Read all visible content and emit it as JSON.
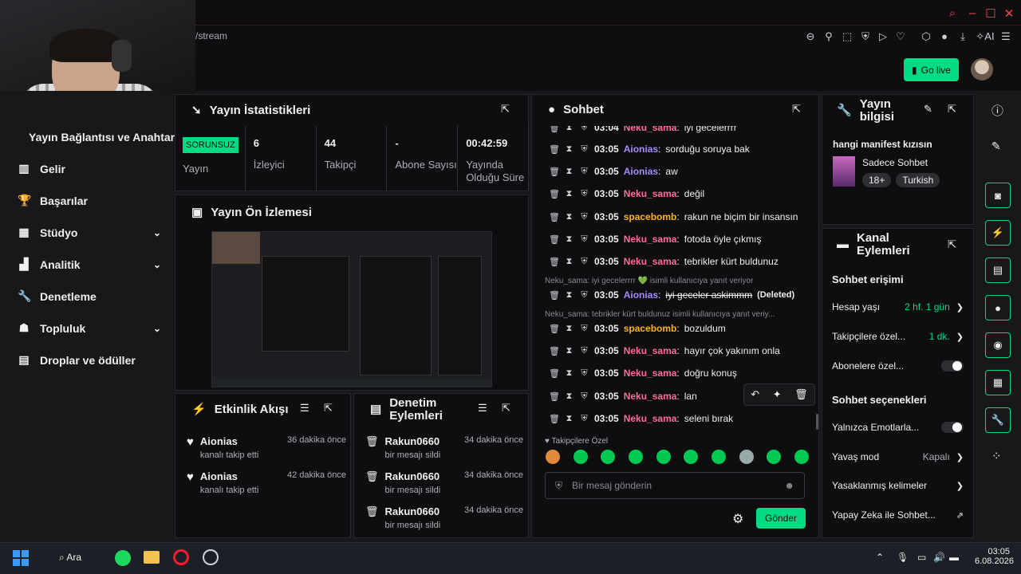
{
  "browser": {
    "url": "/stream",
    "ai_label": "AI"
  },
  "header": {
    "go_live": "Go live"
  },
  "sidebar": {
    "partial_item": "Yayın Bağlantısı ve Anahtarı",
    "items": [
      {
        "label": "Gelir",
        "icon": "bank-icon",
        "chevron": false
      },
      {
        "label": "Başarılar",
        "icon": "trophy-icon",
        "chevron": false
      },
      {
        "label": "Stüdyo",
        "icon": "studio-icon",
        "chevron": true
      },
      {
        "label": "Analitik",
        "icon": "chart-icon",
        "chevron": true
      },
      {
        "label": "Denetleme",
        "icon": "wrench-icon",
        "chevron": false
      },
      {
        "label": "Topluluk",
        "icon": "community-icon",
        "chevron": true
      },
      {
        "label": "Droplar ve ödüller",
        "icon": "gift-icon",
        "chevron": false
      }
    ]
  },
  "stats": {
    "title": "Yayın İstatistikleri",
    "status_badge": "SORUNSUZ",
    "columns": [
      {
        "value": "",
        "label": "Yayın"
      },
      {
        "value": "6",
        "label": "İzleyici"
      },
      {
        "value": "44",
        "label": "Takipçi"
      },
      {
        "value": "-",
        "label": "Abone Sayısı"
      },
      {
        "value": "00:42:59",
        "label": "Yayında Olduğu Süre"
      }
    ]
  },
  "preview": {
    "title": "Yayın Ön İzlemesi"
  },
  "activity": {
    "title": "Etkinlik Akışı",
    "items": [
      {
        "name": "Aionias",
        "desc": "kanalı takip etti",
        "time": "36 dakika önce"
      },
      {
        "name": "Aionias",
        "desc": "kanalı takip etti",
        "time": "42 dakika önce"
      }
    ]
  },
  "moderation": {
    "title": "Denetim Eylemleri",
    "items": [
      {
        "name": "Rakun0660",
        "desc": "bir mesajı sildi",
        "time": "34 dakika önce"
      },
      {
        "name": "Rakun0660",
        "desc": "bir mesajı sildi",
        "time": "34 dakika önce"
      },
      {
        "name": "Rakun0660",
        "desc": "bir mesajı sildi",
        "time": "34 dakika önce"
      }
    ]
  },
  "chat": {
    "title": "Sohbet",
    "messages": [
      {
        "time": "03:04",
        "user": "Neku_sama",
        "color": "#ff6b9a",
        "text": "iyi gecelerrrr"
      },
      {
        "time": "03:05",
        "user": "Aionias",
        "color": "#a78bfa",
        "text": "sorduğu soruya bak"
      },
      {
        "time": "03:05",
        "user": "Aionias",
        "color": "#a78bfa",
        "text": "aw"
      },
      {
        "time": "03:05",
        "user": "Neku_sama",
        "color": "#ff6b9a",
        "text": "değil"
      },
      {
        "time": "03:05",
        "user": "spacebomb",
        "color": "#ffb020",
        "text": "rakun ne biçim bir insansın"
      },
      {
        "time": "03:05",
        "user": "Neku_sama",
        "color": "#ff6b9a",
        "text": "fotoda öyle çıkmış"
      },
      {
        "time": "03:05",
        "user": "Neku_sama",
        "color": "#ff6b9a",
        "text": "tebrikler kürt buldunuz"
      },
      {
        "time": "03:05",
        "user": "Aionias",
        "color": "#a78bfa",
        "text": "iyi geceler askimmm",
        "deleted": "(Deleted)"
      },
      {
        "time": "03:05",
        "user": "spacebomb",
        "color": "#ffb020",
        "text": "bozuldum"
      },
      {
        "time": "03:05",
        "user": "Neku_sama",
        "color": "#ff6b9a",
        "text": "hayır çok yakınım onla"
      },
      {
        "time": "03:05",
        "user": "Neku_sama",
        "color": "#ff6b9a",
        "text": "doğru konuş"
      },
      {
        "time": "03:05",
        "user": "Neku_sama",
        "color": "#ff6b9a",
        "text": "lan"
      },
      {
        "time": "03:05",
        "user": "Neku_sama",
        "color": "#ff6b9a",
        "text": "seleni bırak"
      }
    ],
    "reply_notes": [
      "Neku_sama: iyi gecelerrrr 💚 isimli kullanıcıya yanıt veriyor",
      "Neku_sama: tebrikler kürt buldunuz isimli kullanıcıya yanıt veriy..."
    ],
    "followers_only": "Takipçilere Özel",
    "input_placeholder": "Bir mesaj gönderin",
    "send": "Gönder"
  },
  "stream_info": {
    "title": "Yayın bilgisi",
    "stream_title": "hangi manifest kızısın",
    "category": "Sadece Sohbet",
    "tags": [
      "18+",
      "Turkish"
    ]
  },
  "channel_actions": {
    "title": "Kanal Eylemleri",
    "chat_access": "Sohbet erişimi",
    "account_age_label": "Hesap yaşı",
    "account_age_value": "2 hf. 1 gün",
    "followers_label": "Takipçilere özel...",
    "followers_value": "1 dk.",
    "subs_label": "Abonelere özel...",
    "chat_options": "Sohbet seçenekleri",
    "emotes_label": "Yalnızca Emotlarla...",
    "slow_label": "Yavaş mod",
    "slow_value": "Kapalı",
    "banned_words": "Yasaklanmış kelimeler",
    "ai_chat": "Yapay Zeka ile Sohbet..."
  },
  "taskbar": {
    "search": "Ara",
    "time": "03:05",
    "date": "6.08.2026"
  }
}
